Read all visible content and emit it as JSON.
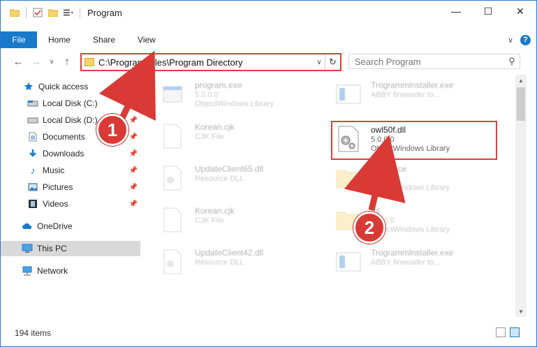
{
  "window": {
    "title": "Program"
  },
  "window_buttons": {
    "minimize": "—",
    "maximize": "☐",
    "close": "✕"
  },
  "ribbon": {
    "tabs": [
      "File",
      "Home",
      "Share",
      "View"
    ]
  },
  "address": {
    "path": "C:\\Program Files\\Program Directory"
  },
  "search": {
    "placeholder": "Search Program"
  },
  "sidebar": {
    "items": [
      {
        "label": "Quick access",
        "icon": "star-icon"
      },
      {
        "label": "Local Disk (C:)",
        "icon": "drive-icon",
        "pinned": true
      },
      {
        "label": "Local Disk (D:)",
        "icon": "drive-icon",
        "pinned": true
      },
      {
        "label": "Documents",
        "icon": "documents-icon",
        "pinned": true
      },
      {
        "label": "Downloads",
        "icon": "download-icon",
        "pinned": true
      },
      {
        "label": "Music",
        "icon": "music-icon",
        "pinned": true
      },
      {
        "label": "Pictures",
        "icon": "pictures-icon",
        "pinned": true
      },
      {
        "label": "Videos",
        "icon": "videos-icon",
        "pinned": true
      },
      {
        "label": "OneDrive",
        "icon": "cloud-icon"
      },
      {
        "label": "This PC",
        "icon": "computer-icon",
        "selected": true
      },
      {
        "label": "Network",
        "icon": "network-icon"
      }
    ]
  },
  "files": [
    {
      "name": "program.exe",
      "type": "ObjectWindows Library",
      "version": "5.0.0.0",
      "icon": "exe-icon"
    },
    {
      "name": "Trogrammlnstaller.exe",
      "type": "ABBY fineeader to...",
      "icon": "installer-icon"
    },
    {
      "name": "Korean.cjk",
      "type": "CJK File",
      "icon": "blank-file-icon"
    },
    {
      "name": "owl50f.dll",
      "version": "5.0.0.0",
      "type": "ObjectWindows Library",
      "icon": "dll-gear-icon"
    },
    {
      "name": "UpdateClient65.dll",
      "type": "Resource DLL",
      "icon": "dll-gear-icon"
    },
    {
      "name": "Resource",
      "version": "5.0.0.0",
      "type": "ObjectWindows Library",
      "icon": "folder-icon"
    },
    {
      "name": "Korean.cjk",
      "type": "CJK File",
      "icon": "blank-file-icon"
    },
    {
      "name": "Ml",
      "version": "5.0.0.0",
      "type": "ObjectWindows Library",
      "icon": "folder-icon"
    },
    {
      "name": "UpdateClient42.dll",
      "type": "Resource DLL",
      "icon": "dll-gear-icon"
    },
    {
      "name": "Trogrammlnstaller.exe",
      "type": "ABBY fineeader to...",
      "icon": "installer-icon"
    }
  ],
  "status": {
    "item_count": "194 items"
  },
  "annotations": {
    "step1": "1",
    "step2": "2"
  },
  "colors": {
    "accent": "#1979ca",
    "highlight": "#e03c3c",
    "badge": "#d93a35"
  }
}
